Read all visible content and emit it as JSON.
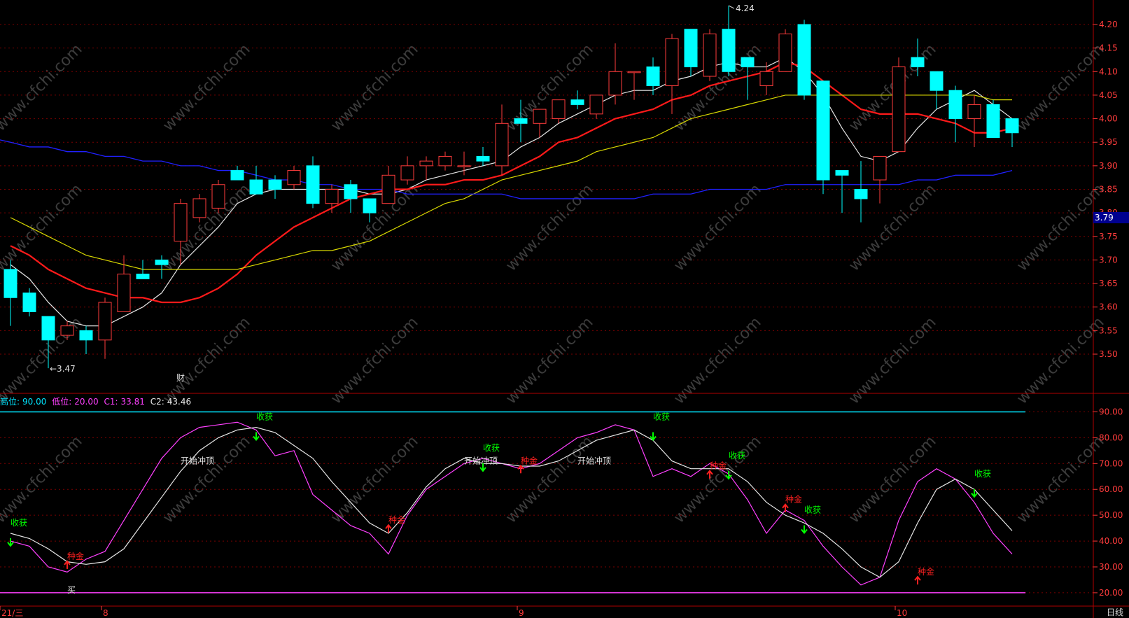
{
  "period_label": "日线",
  "current_price_label": "3.79",
  "indicator_legend": {
    "high_label": "高位:",
    "high_value": "90.00",
    "low_label": "低位:",
    "low_value": "20.00",
    "c1_label": "C1:",
    "c1_value": "33.81",
    "c2_label": "C2:",
    "c2_value": "43.46"
  },
  "colors": {
    "background": "#000000",
    "up": "#ff3c3c",
    "down": "#00ffff",
    "ma_white": "#e6e6e6",
    "ma_red": "#ff1a1a",
    "ma_yellow": "#d8d800",
    "ma_blue": "#2020ff",
    "grid": "#7a0000",
    "axis_text": "#ff3c3c",
    "c1": "#ff40ff",
    "c2": "#e6e6e6",
    "high_line": "#00e5ff",
    "low_line": "#ff40ff",
    "sell_signal": "#00ff00",
    "buy_signal": "#ff2020"
  },
  "watermark_text": "www.cfchi.com",
  "chart_data": [
    {
      "type": "candlestick",
      "ylim": [
        3.45,
        4.23
      ],
      "y_ticks": [
        "3.50",
        "3.55",
        "3.60",
        "3.65",
        "3.70",
        "3.75",
        "3.80",
        "3.85",
        "3.90",
        "3.95",
        "4.00",
        "4.05",
        "4.10",
        "4.15",
        "4.20"
      ],
      "x_tick_labels": [
        {
          "label": "21/三",
          "index": 0
        },
        {
          "label": "8",
          "index": 5
        },
        {
          "label": "9",
          "index": 27
        },
        {
          "label": "10",
          "index": 47
        }
      ],
      "max_label": {
        "text": "4.24",
        "index": 38
      },
      "min_label": {
        "text": "3.47",
        "index": 2
      },
      "event_marker": {
        "text": "财",
        "index": 9
      },
      "candles": [
        {
          "o": 3.68,
          "h": 3.7,
          "l": 3.56,
          "c": 3.62
        },
        {
          "o": 3.63,
          "h": 3.64,
          "l": 3.58,
          "c": 3.59
        },
        {
          "o": 3.58,
          "h": 3.58,
          "l": 3.47,
          "c": 3.53
        },
        {
          "o": 3.54,
          "h": 3.57,
          "l": 3.53,
          "c": 3.56
        },
        {
          "o": 3.55,
          "h": 3.56,
          "l": 3.5,
          "c": 3.53
        },
        {
          "o": 3.53,
          "h": 3.62,
          "l": 3.49,
          "c": 3.61
        },
        {
          "o": 3.59,
          "h": 3.71,
          "l": 3.59,
          "c": 3.67
        },
        {
          "o": 3.67,
          "h": 3.7,
          "l": 3.66,
          "c": 3.66
        },
        {
          "o": 3.7,
          "h": 3.71,
          "l": 3.66,
          "c": 3.69
        },
        {
          "o": 3.74,
          "h": 3.83,
          "l": 3.69,
          "c": 3.82
        },
        {
          "o": 3.79,
          "h": 3.84,
          "l": 3.78,
          "c": 3.83
        },
        {
          "o": 3.81,
          "h": 3.87,
          "l": 3.8,
          "c": 3.86
        },
        {
          "o": 3.89,
          "h": 3.9,
          "l": 3.87,
          "c": 3.87
        },
        {
          "o": 3.87,
          "h": 3.9,
          "l": 3.84,
          "c": 3.84
        },
        {
          "o": 3.87,
          "h": 3.88,
          "l": 3.83,
          "c": 3.85
        },
        {
          "o": 3.86,
          "h": 3.9,
          "l": 3.85,
          "c": 3.89
        },
        {
          "o": 3.9,
          "h": 3.92,
          "l": 3.81,
          "c": 3.82
        },
        {
          "o": 3.82,
          "h": 3.86,
          "l": 3.8,
          "c": 3.85
        },
        {
          "o": 3.86,
          "h": 3.87,
          "l": 3.8,
          "c": 3.83
        },
        {
          "o": 3.83,
          "h": 3.83,
          "l": 3.78,
          "c": 3.8
        },
        {
          "o": 3.82,
          "h": 3.9,
          "l": 3.82,
          "c": 3.88
        },
        {
          "o": 3.87,
          "h": 3.92,
          "l": 3.86,
          "c": 3.9
        },
        {
          "o": 3.9,
          "h": 3.92,
          "l": 3.87,
          "c": 3.91
        },
        {
          "o": 3.9,
          "h": 3.93,
          "l": 3.89,
          "c": 3.92
        },
        {
          "o": 3.9,
          "h": 3.93,
          "l": 3.88,
          "c": 3.9
        },
        {
          "o": 3.92,
          "h": 3.94,
          "l": 3.9,
          "c": 3.91
        },
        {
          "o": 3.9,
          "h": 4.03,
          "l": 3.88,
          "c": 3.99
        },
        {
          "o": 4.0,
          "h": 4.04,
          "l": 3.95,
          "c": 3.99
        },
        {
          "o": 3.99,
          "h": 4.02,
          "l": 3.96,
          "c": 4.02
        },
        {
          "o": 4.0,
          "h": 4.04,
          "l": 3.99,
          "c": 4.04
        },
        {
          "o": 4.04,
          "h": 4.06,
          "l": 4.02,
          "c": 4.03
        },
        {
          "o": 4.01,
          "h": 4.05,
          "l": 4.0,
          "c": 4.05
        },
        {
          "o": 4.05,
          "h": 4.16,
          "l": 4.03,
          "c": 4.1
        },
        {
          "o": 4.1,
          "h": 4.1,
          "l": 4.04,
          "c": 4.1
        },
        {
          "o": 4.11,
          "h": 4.13,
          "l": 4.05,
          "c": 4.07
        },
        {
          "o": 4.07,
          "h": 4.18,
          "l": 4.01,
          "c": 4.17
        },
        {
          "o": 4.19,
          "h": 4.19,
          "l": 4.09,
          "c": 4.11
        },
        {
          "o": 4.09,
          "h": 4.19,
          "l": 4.08,
          "c": 4.18
        },
        {
          "o": 4.19,
          "h": 4.24,
          "l": 4.09,
          "c": 4.1
        },
        {
          "o": 4.13,
          "h": 4.13,
          "l": 4.04,
          "c": 4.11
        },
        {
          "o": 4.07,
          "h": 4.12,
          "l": 4.05,
          "c": 4.1
        },
        {
          "o": 4.1,
          "h": 4.19,
          "l": 4.1,
          "c": 4.18
        },
        {
          "o": 4.2,
          "h": 4.21,
          "l": 4.04,
          "c": 4.05
        },
        {
          "o": 4.08,
          "h": 4.08,
          "l": 3.84,
          "c": 3.87
        },
        {
          "o": 3.89,
          "h": 3.89,
          "l": 3.8,
          "c": 3.88
        },
        {
          "o": 3.85,
          "h": 3.91,
          "l": 3.78,
          "c": 3.83
        },
        {
          "o": 3.87,
          "h": 3.92,
          "l": 3.82,
          "c": 3.92
        },
        {
          "o": 3.93,
          "h": 4.13,
          "l": 3.93,
          "c": 4.11
        },
        {
          "o": 4.13,
          "h": 4.17,
          "l": 4.09,
          "c": 4.11
        },
        {
          "o": 4.1,
          "h": 4.1,
          "l": 4.02,
          "c": 4.06
        },
        {
          "o": 4.06,
          "h": 4.07,
          "l": 3.95,
          "c": 4.0
        },
        {
          "o": 4.0,
          "h": 4.05,
          "l": 3.94,
          "c": 4.03
        },
        {
          "o": 4.03,
          "h": 4.04,
          "l": 3.96,
          "c": 3.96
        },
        {
          "o": 4.0,
          "h": 4.0,
          "l": 3.94,
          "c": 3.97
        }
      ],
      "series": [
        {
          "key": "ma_white",
          "values": [
            3.69,
            3.66,
            3.61,
            3.57,
            3.56,
            3.56,
            3.58,
            3.6,
            3.63,
            3.69,
            3.73,
            3.77,
            3.82,
            3.84,
            3.85,
            3.85,
            3.85,
            3.85,
            3.85,
            3.84,
            3.84,
            3.85,
            3.87,
            3.88,
            3.89,
            3.9,
            3.91,
            3.94,
            3.96,
            3.99,
            4.01,
            4.03,
            4.05,
            4.06,
            4.06,
            4.08,
            4.09,
            4.11,
            4.12,
            4.11,
            4.11,
            4.13,
            4.1,
            4.05,
            3.98,
            3.92,
            3.91,
            3.93,
            3.98,
            4.02,
            4.04,
            4.06,
            4.03,
            4.0
          ]
        },
        {
          "key": "ma_red",
          "values": [
            3.73,
            3.71,
            3.68,
            3.66,
            3.64,
            3.63,
            3.62,
            3.62,
            3.61,
            3.61,
            3.62,
            3.64,
            3.67,
            3.71,
            3.74,
            3.77,
            3.79,
            3.81,
            3.83,
            3.84,
            3.85,
            3.85,
            3.86,
            3.86,
            3.87,
            3.87,
            3.88,
            3.9,
            3.92,
            3.95,
            3.96,
            3.98,
            4.0,
            4.01,
            4.02,
            4.04,
            4.05,
            4.07,
            4.08,
            4.09,
            4.1,
            4.12,
            4.11,
            4.08,
            4.05,
            4.02,
            4.01,
            4.01,
            4.01,
            4.0,
            3.99,
            3.97,
            3.97,
            3.98
          ]
        },
        {
          "key": "ma_yellow",
          "values": [
            3.79,
            3.77,
            3.75,
            3.73,
            3.71,
            3.7,
            3.69,
            3.68,
            3.68,
            3.68,
            3.68,
            3.68,
            3.68,
            3.69,
            3.7,
            3.71,
            3.72,
            3.72,
            3.73,
            3.74,
            3.76,
            3.78,
            3.8,
            3.82,
            3.83,
            3.85,
            3.87,
            3.88,
            3.89,
            3.9,
            3.91,
            3.93,
            3.94,
            3.95,
            3.96,
            3.98,
            4.0,
            4.01,
            4.02,
            4.03,
            4.04,
            4.05,
            4.05,
            4.05,
            4.05,
            4.05,
            4.05,
            4.05,
            4.05,
            4.05,
            4.05,
            4.05,
            4.04,
            4.04
          ]
        },
        {
          "key": "ma_blue",
          "values": [
            3.95,
            3.94,
            3.94,
            3.93,
            3.93,
            3.92,
            3.92,
            3.91,
            3.91,
            3.9,
            3.9,
            3.89,
            3.89,
            3.88,
            3.87,
            3.87,
            3.86,
            3.86,
            3.85,
            3.85,
            3.85,
            3.84,
            3.84,
            3.84,
            3.84,
            3.84,
            3.84,
            3.83,
            3.83,
            3.83,
            3.83,
            3.83,
            3.83,
            3.83,
            3.84,
            3.84,
            3.84,
            3.85,
            3.85,
            3.85,
            3.85,
            3.86,
            3.86,
            3.86,
            3.86,
            3.86,
            3.86,
            3.86,
            3.87,
            3.87,
            3.88,
            3.88,
            3.88,
            3.89
          ]
        }
      ]
    },
    {
      "type": "line",
      "ylim": [
        17,
        95
      ],
      "y_ticks": [
        "20.00",
        "30.00",
        "40.00",
        "50.00",
        "60.00",
        "70.00",
        "80.00",
        "90.00"
      ],
      "reference_lines": [
        {
          "key": "high",
          "value": 90
        },
        {
          "key": "low",
          "value": 20
        }
      ],
      "series": [
        {
          "name": "C1",
          "values": [
            40,
            38,
            30,
            28,
            33,
            36,
            48,
            60,
            72,
            80,
            84,
            85,
            86,
            83,
            73,
            75,
            58,
            52,
            46,
            43,
            35,
            50,
            60,
            65,
            70,
            72,
            70,
            68,
            70,
            75,
            80,
            82,
            85,
            83,
            65,
            68,
            65,
            70,
            66,
            56,
            43,
            52,
            48,
            38,
            30,
            23,
            26,
            48,
            63,
            68,
            64,
            55,
            43,
            35
          ]
        },
        {
          "name": "C2",
          "values": [
            43,
            41,
            37,
            32,
            31,
            32,
            37,
            47,
            57,
            67,
            75,
            80,
            83,
            84,
            82,
            77,
            72,
            63,
            55,
            47,
            43,
            51,
            61,
            68,
            72,
            70,
            70,
            69,
            69,
            71,
            75,
            79,
            81,
            83,
            79,
            71,
            68,
            68,
            68,
            63,
            55,
            50,
            47,
            43,
            37,
            30,
            26,
            32,
            47,
            60,
            64,
            60,
            52,
            44
          ]
        }
      ],
      "annotations": [
        {
          "text": "收获",
          "index": 0,
          "value": 46,
          "kind": "sell"
        },
        {
          "text": "种金",
          "index": 3,
          "value": 33,
          "kind": "buy"
        },
        {
          "text": "买",
          "index": 3,
          "value": 20,
          "kind": "plain"
        },
        {
          "text": "开始冲顶",
          "index": 9,
          "value": 70,
          "kind": "plain"
        },
        {
          "text": "收获",
          "index": 13,
          "value": 87,
          "kind": "sell"
        },
        {
          "text": "种金",
          "index": 20,
          "value": 47,
          "kind": "buy"
        },
        {
          "text": "收获",
          "index": 25,
          "value": 75,
          "kind": "sell"
        },
        {
          "text": "开始冲顶",
          "index": 24,
          "value": 70,
          "kind": "plain"
        },
        {
          "text": "种金",
          "index": 27,
          "value": 70,
          "kind": "buy"
        },
        {
          "text": "开始冲顶",
          "index": 30,
          "value": 70,
          "kind": "plain"
        },
        {
          "text": "收获",
          "index": 34,
          "value": 87,
          "kind": "sell"
        },
        {
          "text": "种金",
          "index": 37,
          "value": 68,
          "kind": "buy"
        },
        {
          "text": "收获",
          "index": 38,
          "value": 72,
          "kind": "sell"
        },
        {
          "text": "种金",
          "index": 41,
          "value": 55,
          "kind": "buy"
        },
        {
          "text": "收获",
          "index": 42,
          "value": 51,
          "kind": "sell"
        },
        {
          "text": "种金",
          "index": 48,
          "value": 27,
          "kind": "buy"
        },
        {
          "text": "收获",
          "index": 51,
          "value": 65,
          "kind": "sell"
        }
      ]
    }
  ]
}
